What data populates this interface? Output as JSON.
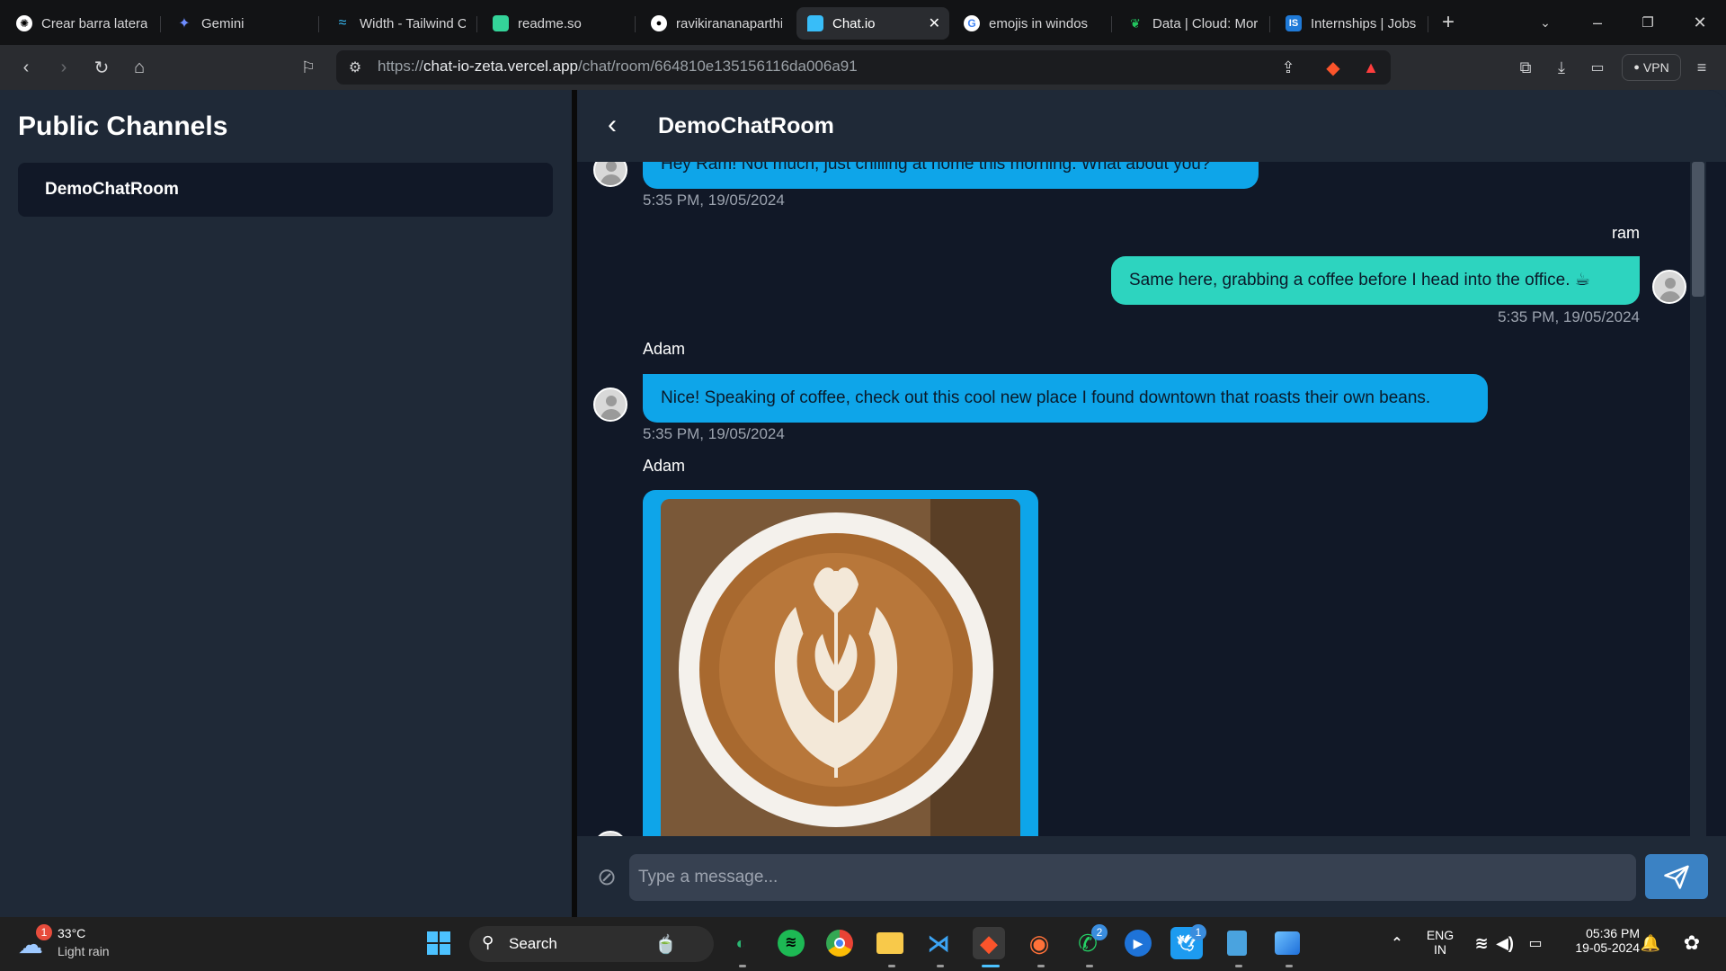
{
  "browser": {
    "tabs": [
      {
        "label": "Crear barra lateral",
        "icon": "openai-icon"
      },
      {
        "label": "Gemini",
        "icon": "gemini-icon"
      },
      {
        "label": "Width - Tailwind C",
        "icon": "tailwind-icon"
      },
      {
        "label": "readme.so",
        "icon": "readme-icon"
      },
      {
        "label": "ravikirananaparthi",
        "icon": "github-icon"
      },
      {
        "label": "Chat.io",
        "icon": "chat-icon"
      },
      {
        "label": "emojis in windos",
        "icon": "google-icon"
      },
      {
        "label": "Data | Cloud: Mor",
        "icon": "mongodb-icon"
      },
      {
        "label": "Internships | Jobs",
        "icon": "internshala-icon"
      }
    ],
    "url_scheme": "https://",
    "url_host": "chat-io-zeta.vercel.app",
    "url_path": "/chat/room/664810e135156116da006a91",
    "vpn_label": "VPN"
  },
  "sidebar": {
    "title": "Public Channels",
    "channels": [
      "DemoChatRoom"
    ]
  },
  "chat": {
    "room_title": "DemoChatRoom",
    "messages": [
      {
        "sender": "",
        "text": "Hey Ram! Not much, just chilling at home this morning. What about you?",
        "time": "5:35 PM, 19/05/2024"
      },
      {
        "sender": "ram",
        "text": "Same here, grabbing a coffee before I head into the office. ☕",
        "time": "5:35 PM, 19/05/2024"
      },
      {
        "sender": "Adam",
        "text": "Nice! Speaking of coffee, check out this cool new place I found downtown that roasts their own beans.",
        "time": "5:35 PM, 19/05/2024"
      },
      {
        "sender": "Adam",
        "text": "",
        "time": ""
      }
    ],
    "input_placeholder": "Type a message...",
    "input_value": ""
  },
  "taskbar": {
    "weather_temp": "33°C",
    "weather_desc": "Light rain",
    "weather_badge": "1",
    "search_label": "Search",
    "lang": "ENG",
    "region": "IN",
    "time": "05:36 PM",
    "date": "19-05-2024",
    "whatsapp_badge": "2",
    "twitter_badge": "1"
  },
  "colors": {
    "incoming_bubble": "#0ea5e9",
    "outgoing_bubble": "#2dd4bf",
    "panel_bg": "#111827",
    "sidebar_bg": "#1f2937",
    "send_button": "#3b82c4"
  }
}
